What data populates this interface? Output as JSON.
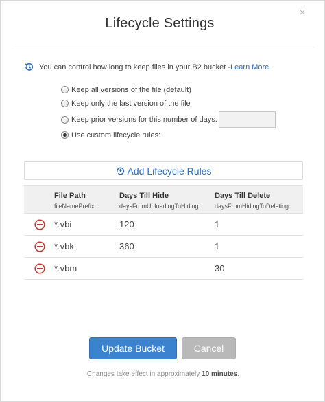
{
  "dialog": {
    "title": "Lifecycle Settings",
    "close_label": "×"
  },
  "info": {
    "text": "You can control how long to keep files in your B2 bucket - ",
    "link": "Learn More",
    "after_link": "."
  },
  "options": [
    {
      "label": "Keep all versions of the file (default)",
      "checked": false
    },
    {
      "label": "Keep only the last version of the file",
      "checked": false
    },
    {
      "label": "Keep prior versions for this number of days:",
      "checked": false
    },
    {
      "label": "Use custom lifecycle rules:",
      "checked": true
    }
  ],
  "days_input": {
    "value": ""
  },
  "add_rules": {
    "label": "Add Lifecycle Rules"
  },
  "table": {
    "columns": [
      {
        "title": "File Path",
        "subtitle": "fileNamePrefix"
      },
      {
        "title": "Days Till Hide",
        "subtitle": "daysFromUploadingToHiding"
      },
      {
        "title": "Days Till Delete",
        "subtitle": "daysFromHidingToDeleting"
      }
    ],
    "rows": [
      {
        "path": "*.vbi",
        "hide": "120",
        "delete": "1"
      },
      {
        "path": "*.vbk",
        "hide": "360",
        "delete": "1"
      },
      {
        "path": "*.vbm",
        "hide": "",
        "delete": "30"
      }
    ]
  },
  "buttons": {
    "update": "Update Bucket",
    "cancel": "Cancel"
  },
  "footer": {
    "prefix": "Changes take effect in approximately ",
    "bold": "10 minutes",
    "suffix": "."
  },
  "colors": {
    "link": "#2d6ebd",
    "primary_button": "#3b82cf",
    "cancel_button": "#b9b9b9",
    "remove_icon": "#c0392b"
  }
}
